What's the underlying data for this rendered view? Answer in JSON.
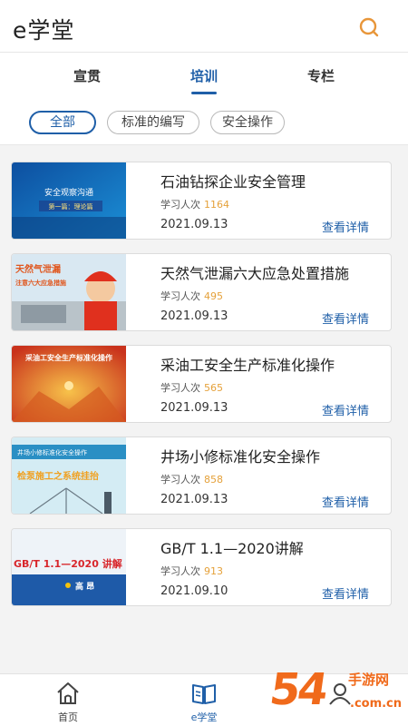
{
  "header": {
    "title": "e学堂",
    "search_icon": "search-icon"
  },
  "tabs": [
    {
      "label": "宣贯",
      "active": false
    },
    {
      "label": "培训",
      "active": true
    },
    {
      "label": "专栏",
      "active": false
    }
  ],
  "filters": [
    {
      "label": "全部",
      "active": true
    },
    {
      "label": "标准的编写",
      "active": false
    },
    {
      "label": "安全操作",
      "active": false
    }
  ],
  "courses": [
    {
      "title": "石油钻探企业安全管理",
      "learn_label": "学习人次",
      "count": "1164",
      "date": "2021.09.13",
      "detail_label": "查看详情",
      "thumb_text_1": "安全观察沟通",
      "thumb_text_2": "第一篇：理论篇"
    },
    {
      "title": "天然气泄漏六大应急处置措施",
      "learn_label": "学习人次",
      "count": "495",
      "date": "2021.09.13",
      "detail_label": "查看详情",
      "thumb_text_1": "天然气泄漏",
      "thumb_text_2": "注意六大应急措施"
    },
    {
      "title": "采油工安全生产标准化操作",
      "learn_label": "学习人次",
      "count": "565",
      "date": "2021.09.13",
      "detail_label": "查看详情",
      "thumb_text_1": "采油工安全生产标准化操作",
      "thumb_text_2": ""
    },
    {
      "title": "井场小修标准化安全操作",
      "learn_label": "学习人次",
      "count": "858",
      "date": "2021.09.13",
      "detail_label": "查看详情",
      "thumb_text_1": "井场小修标准化安全操作",
      "thumb_text_2": "检泵施工之系统挂抬"
    },
    {
      "title": "GB/T 1.1—2020讲解",
      "learn_label": "学习人次",
      "count": "913",
      "date": "2021.09.10",
      "detail_label": "查看详情",
      "thumb_text_1": "GB/T 1.1—2020 讲解",
      "thumb_text_2": "高 昂"
    }
  ],
  "bottom_nav": [
    {
      "label": "首页",
      "icon": "home-icon",
      "active": false
    },
    {
      "label": "e学堂",
      "icon": "book-icon",
      "active": true
    },
    {
      "label": "",
      "icon": "user-icon",
      "active": false
    }
  ],
  "watermark": {
    "number": "54",
    "text": "手游网",
    "url": ".com.cn"
  },
  "colors": {
    "accent": "#1f5fa8",
    "count": "#e5a13a",
    "watermark": "#f06a1b"
  }
}
